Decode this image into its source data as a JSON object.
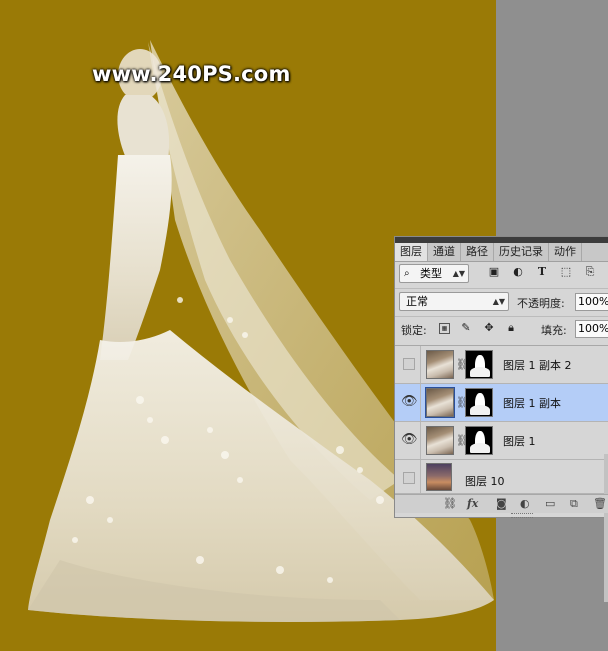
{
  "watermark": "www.240PS.com",
  "colors": {
    "canvas": "#9a7a06",
    "workspace": "#8f8f8f",
    "selected_layer": "#b4cdf7"
  },
  "panel": {
    "tabs": [
      "图层",
      "通道",
      "路径",
      "历史记录",
      "动作"
    ],
    "filter": {
      "label": "类型",
      "icon": "search-icon"
    },
    "filter_icons": [
      "image-filter-icon",
      "adjustment-filter-icon",
      "type-filter-icon",
      "shape-filter-icon",
      "smart-object-filter-icon"
    ],
    "blend_mode": "正常",
    "opacity_label": "不透明度:",
    "opacity_value": "100%",
    "lock_label": "锁定:",
    "lock_icons": [
      "lock-transparent-icon",
      "lock-paint-icon",
      "lock-position-icon",
      "lock-all-icon"
    ],
    "fill_label": "填充:",
    "fill_value": "100%",
    "layers": [
      {
        "name": "图层 1 副本 2",
        "visible": false,
        "selected": false
      },
      {
        "name": "图层 1 副本",
        "visible": true,
        "selected": true
      },
      {
        "name": "图层 1",
        "visible": true,
        "selected": false
      },
      {
        "name": "图层 10",
        "visible": false,
        "selected": false
      }
    ],
    "bottom_icons": [
      "link-layers-icon",
      "fx-icon",
      "add-mask-icon",
      "adjustment-layer-icon",
      "new-group-icon",
      "new-layer-icon",
      "delete-layer-icon"
    ],
    "fx_label": "fx"
  }
}
